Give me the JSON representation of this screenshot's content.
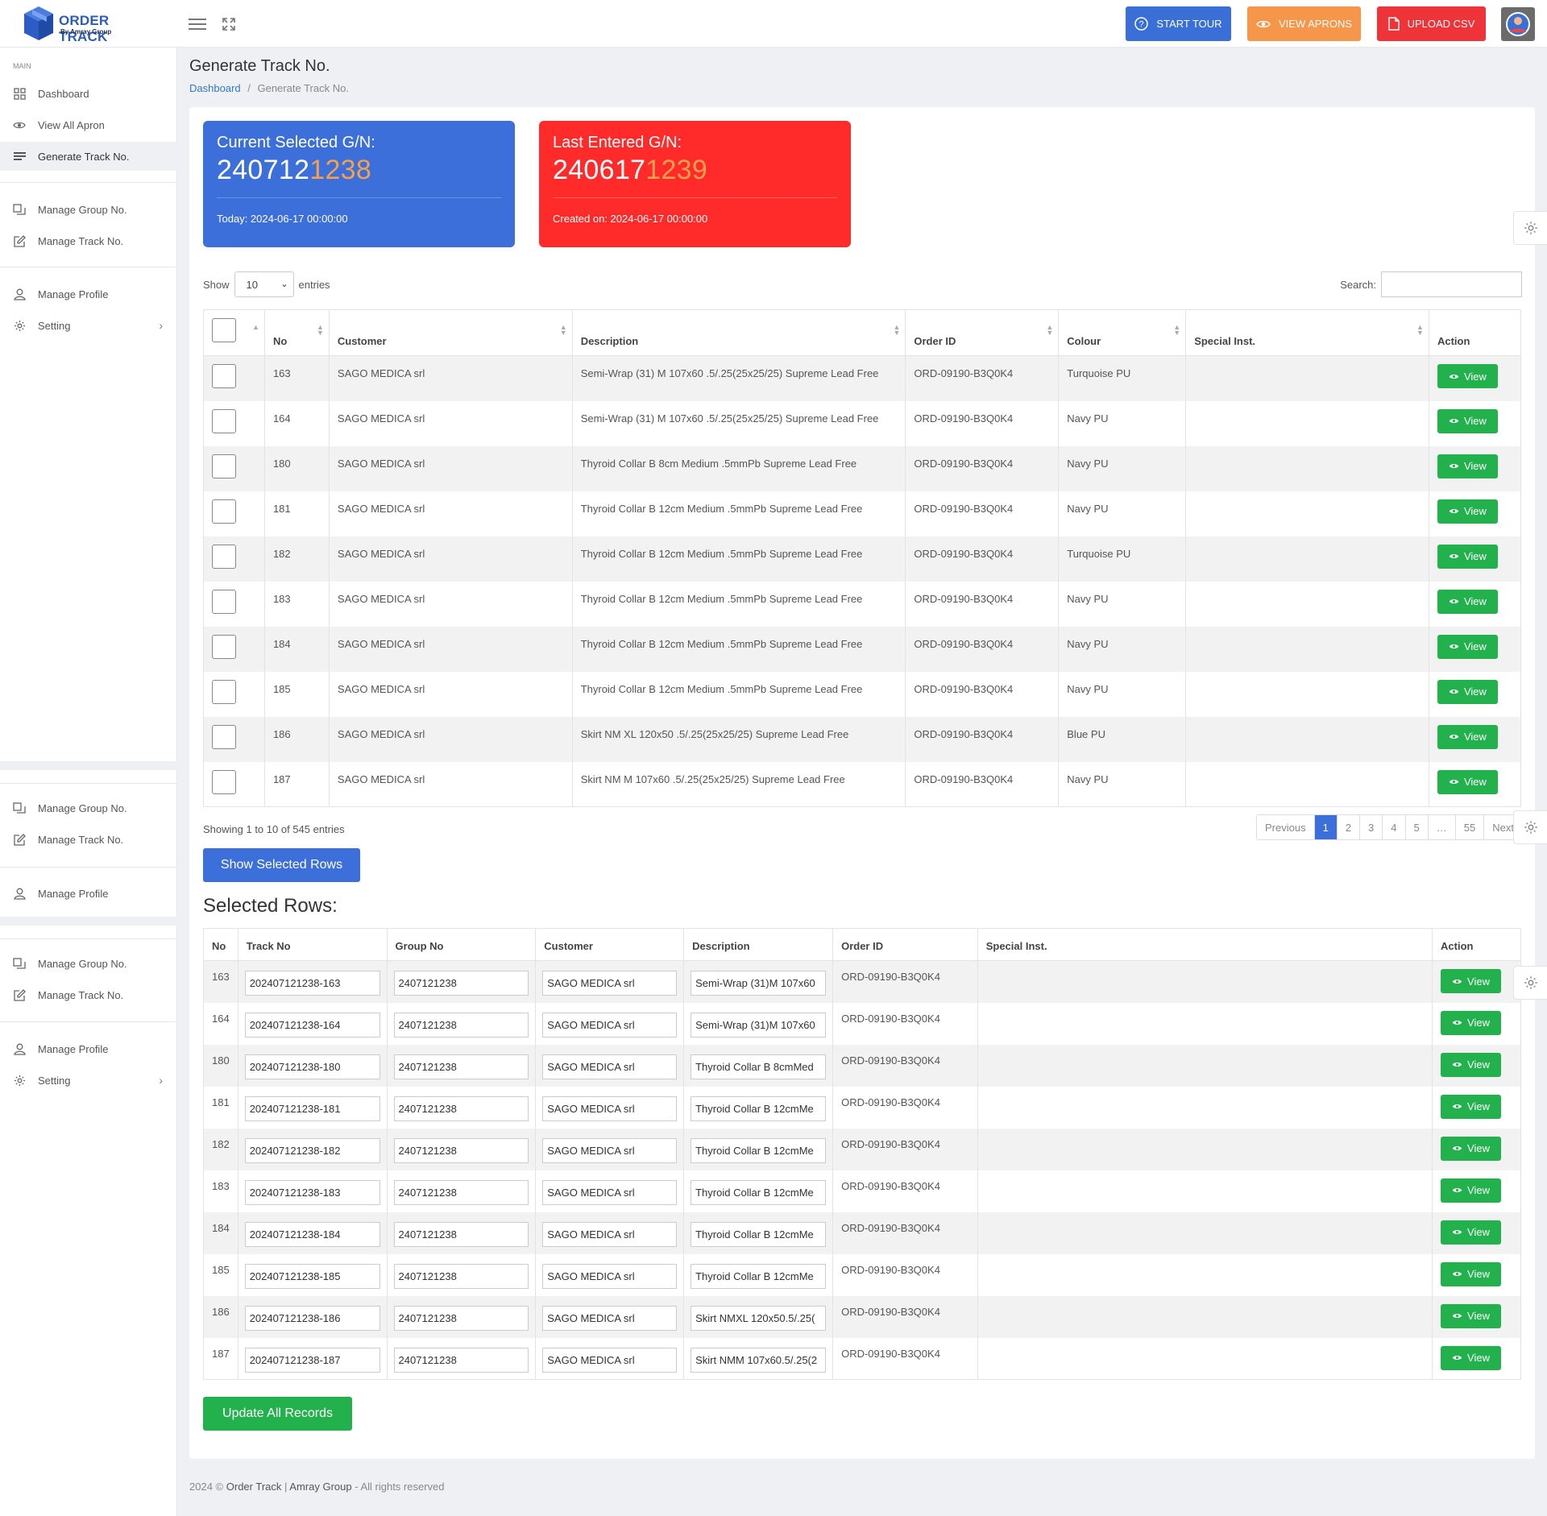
{
  "brand": {
    "title": "ORDER TRACK",
    "subtitle": "By Amray Group"
  },
  "header": {
    "buttons": [
      {
        "label": "START TOUR",
        "icon": "question-circle-icon",
        "color": "#3a6fd8"
      },
      {
        "label": "VIEW APRONS",
        "icon": "eye-icon",
        "color": "#f5964a"
      },
      {
        "label": "UPLOAD CSV",
        "icon": "file-icon",
        "color": "#ee3438"
      }
    ]
  },
  "sidebar": {
    "main_label": "MAIN",
    "group1": [
      {
        "label": "Dashboard",
        "icon": "grid-icon"
      },
      {
        "label": "View All Apron",
        "icon": "eye-icon"
      },
      {
        "label": "Generate Track No.",
        "icon": "list-icon",
        "active": true
      }
    ],
    "group2": [
      {
        "label": "Manage Group No.",
        "icon": "copy-icon"
      },
      {
        "label": "Manage Track No.",
        "icon": "edit-icon"
      }
    ],
    "group3": [
      {
        "label": "Manage Profile",
        "icon": "user-icon"
      },
      {
        "label": "Setting",
        "icon": "gear-icon"
      }
    ],
    "group4": [
      {
        "label": "Manage Group No.",
        "icon": "copy-icon"
      },
      {
        "label": "Manage Track No.",
        "icon": "edit-icon"
      }
    ],
    "group5": [
      {
        "label": "Manage Profile",
        "icon": "user-icon"
      }
    ],
    "group6": [
      {
        "label": "Manage Group No.",
        "icon": "copy-icon"
      },
      {
        "label": "Manage Track No.",
        "icon": "edit-icon"
      }
    ],
    "group7": [
      {
        "label": "Manage Profile",
        "icon": "user-icon"
      },
      {
        "label": "Setting",
        "icon": "gear-icon"
      }
    ]
  },
  "page": {
    "title": "Generate Track No.",
    "breadcrumb_home": "Dashboard",
    "breadcrumb_sep": "/",
    "breadcrumb_current": "Generate Track No."
  },
  "current_gn": {
    "label": "Current Selected G/N:",
    "prefix": "240712",
    "highlight": "1238",
    "date": "Today: 2024-06-17 00:00:00"
  },
  "last_gn": {
    "label": "Last Entered G/N:",
    "prefix": "240617",
    "highlight": "1239",
    "date": "Created on: 2024-06-17 00:00:00"
  },
  "colors": {
    "blue": "#3c6fd9",
    "red": "#ff2b2b",
    "green": "#22b14c",
    "orange": "#f5a04e"
  },
  "datatable": {
    "show_label": "Show",
    "entries_label": "entries",
    "page_size": "10",
    "search_label": "Search:",
    "columns": [
      "No",
      "Customer",
      "Description",
      "Order ID",
      "Colour",
      "Special Inst.",
      "Action"
    ],
    "view_label": "View",
    "rows": [
      {
        "no": "163",
        "customer": "SAGO MEDICA srl",
        "description": "Semi-Wrap (31) M 107x60 .5/.25(25x25/25) Supreme Lead Free",
        "order_id": "ORD-09190-B3Q0K4",
        "colour": "Turquoise PU",
        "special": ""
      },
      {
        "no": "164",
        "customer": "SAGO MEDICA srl",
        "description": "Semi-Wrap (31) M 107x60 .5/.25(25x25/25) Supreme Lead Free",
        "order_id": "ORD-09190-B3Q0K4",
        "colour": "Navy PU",
        "special": ""
      },
      {
        "no": "180",
        "customer": "SAGO MEDICA srl",
        "description": "Thyroid Collar B 8cm Medium .5mmPb Supreme Lead Free",
        "order_id": "ORD-09190-B3Q0K4",
        "colour": "Navy PU",
        "special": ""
      },
      {
        "no": "181",
        "customer": "SAGO MEDICA srl",
        "description": "Thyroid Collar B 12cm Medium .5mmPb Supreme Lead Free",
        "order_id": "ORD-09190-B3Q0K4",
        "colour": "Navy PU",
        "special": ""
      },
      {
        "no": "182",
        "customer": "SAGO MEDICA srl",
        "description": "Thyroid Collar B 12cm Medium .5mmPb Supreme Lead Free",
        "order_id": "ORD-09190-B3Q0K4",
        "colour": "Turquoise PU",
        "special": ""
      },
      {
        "no": "183",
        "customer": "SAGO MEDICA srl",
        "description": "Thyroid Collar B 12cm Medium .5mmPb Supreme Lead Free",
        "order_id": "ORD-09190-B3Q0K4",
        "colour": "Navy PU",
        "special": ""
      },
      {
        "no": "184",
        "customer": "SAGO MEDICA srl",
        "description": "Thyroid Collar B 12cm Medium .5mmPb Supreme Lead Free",
        "order_id": "ORD-09190-B3Q0K4",
        "colour": "Navy PU",
        "special": ""
      },
      {
        "no": "185",
        "customer": "SAGO MEDICA srl",
        "description": "Thyroid Collar B 12cm Medium .5mmPb Supreme Lead Free",
        "order_id": "ORD-09190-B3Q0K4",
        "colour": "Navy PU",
        "special": ""
      },
      {
        "no": "186",
        "customer": "SAGO MEDICA srl",
        "description": "Skirt NM XL 120x50 .5/.25(25x25/25) Supreme Lead Free",
        "order_id": "ORD-09190-B3Q0K4",
        "colour": "Blue PU",
        "special": ""
      },
      {
        "no": "187",
        "customer": "SAGO MEDICA srl",
        "description": "Skirt NM M 107x60 .5/.25(25x25/25) Supreme Lead Free",
        "order_id": "ORD-09190-B3Q0K4",
        "colour": "Navy PU",
        "special": ""
      }
    ],
    "info": "Showing 1 to 10 of 545 entries",
    "pagination": [
      "Previous",
      "1",
      "2",
      "3",
      "4",
      "5",
      "…",
      "55",
      "Next"
    ],
    "current_page": "1"
  },
  "show_selected_label": "Show Selected Rows",
  "selected": {
    "title": "Selected Rows:",
    "columns": [
      "No",
      "Track No",
      "Group No",
      "Customer",
      "Description",
      "Order ID",
      "Special Inst.",
      "Action"
    ],
    "rows": [
      {
        "no": "163",
        "track": "202407121238-163",
        "group": "2407121238",
        "customer": "SAGO MEDICA srl",
        "description": "Semi-Wrap (31)M 107x60",
        "order_id": "ORD-09190-B3Q0K4"
      },
      {
        "no": "164",
        "track": "202407121238-164",
        "group": "2407121238",
        "customer": "SAGO MEDICA srl",
        "description": "Semi-Wrap (31)M 107x60",
        "order_id": "ORD-09190-B3Q0K4"
      },
      {
        "no": "180",
        "track": "202407121238-180",
        "group": "2407121238",
        "customer": "SAGO MEDICA srl",
        "description": "Thyroid Collar B 8cmMed",
        "order_id": "ORD-09190-B3Q0K4"
      },
      {
        "no": "181",
        "track": "202407121238-181",
        "group": "2407121238",
        "customer": "SAGO MEDICA srl",
        "description": "Thyroid Collar B 12cmMe",
        "order_id": "ORD-09190-B3Q0K4"
      },
      {
        "no": "182",
        "track": "202407121238-182",
        "group": "2407121238",
        "customer": "SAGO MEDICA srl",
        "description": "Thyroid Collar B 12cmMe",
        "order_id": "ORD-09190-B3Q0K4"
      },
      {
        "no": "183",
        "track": "202407121238-183",
        "group": "2407121238",
        "customer": "SAGO MEDICA srl",
        "description": "Thyroid Collar B 12cmMe",
        "order_id": "ORD-09190-B3Q0K4"
      },
      {
        "no": "184",
        "track": "202407121238-184",
        "group": "2407121238",
        "customer": "SAGO MEDICA srl",
        "description": "Thyroid Collar B 12cmMe",
        "order_id": "ORD-09190-B3Q0K4"
      },
      {
        "no": "185",
        "track": "202407121238-185",
        "group": "2407121238",
        "customer": "SAGO MEDICA srl",
        "description": "Thyroid Collar B 12cmMe",
        "order_id": "ORD-09190-B3Q0K4"
      },
      {
        "no": "186",
        "track": "202407121238-186",
        "group": "2407121238",
        "customer": "SAGO MEDICA srl",
        "description": "Skirt NMXL 120x50.5/.25(",
        "order_id": "ORD-09190-B3Q0K4"
      },
      {
        "no": "187",
        "track": "202407121238-187",
        "group": "2407121238",
        "customer": "SAGO MEDICA srl",
        "description": "Skirt NMM 107x60.5/.25(2",
        "order_id": "ORD-09190-B3Q0K4"
      }
    ]
  },
  "update_label": "Update All Records",
  "footer": {
    "year": "2024 ©",
    "app": "Order Track",
    "sep": "|",
    "company": "Amray Group",
    "rights": "- All rights reserved"
  }
}
